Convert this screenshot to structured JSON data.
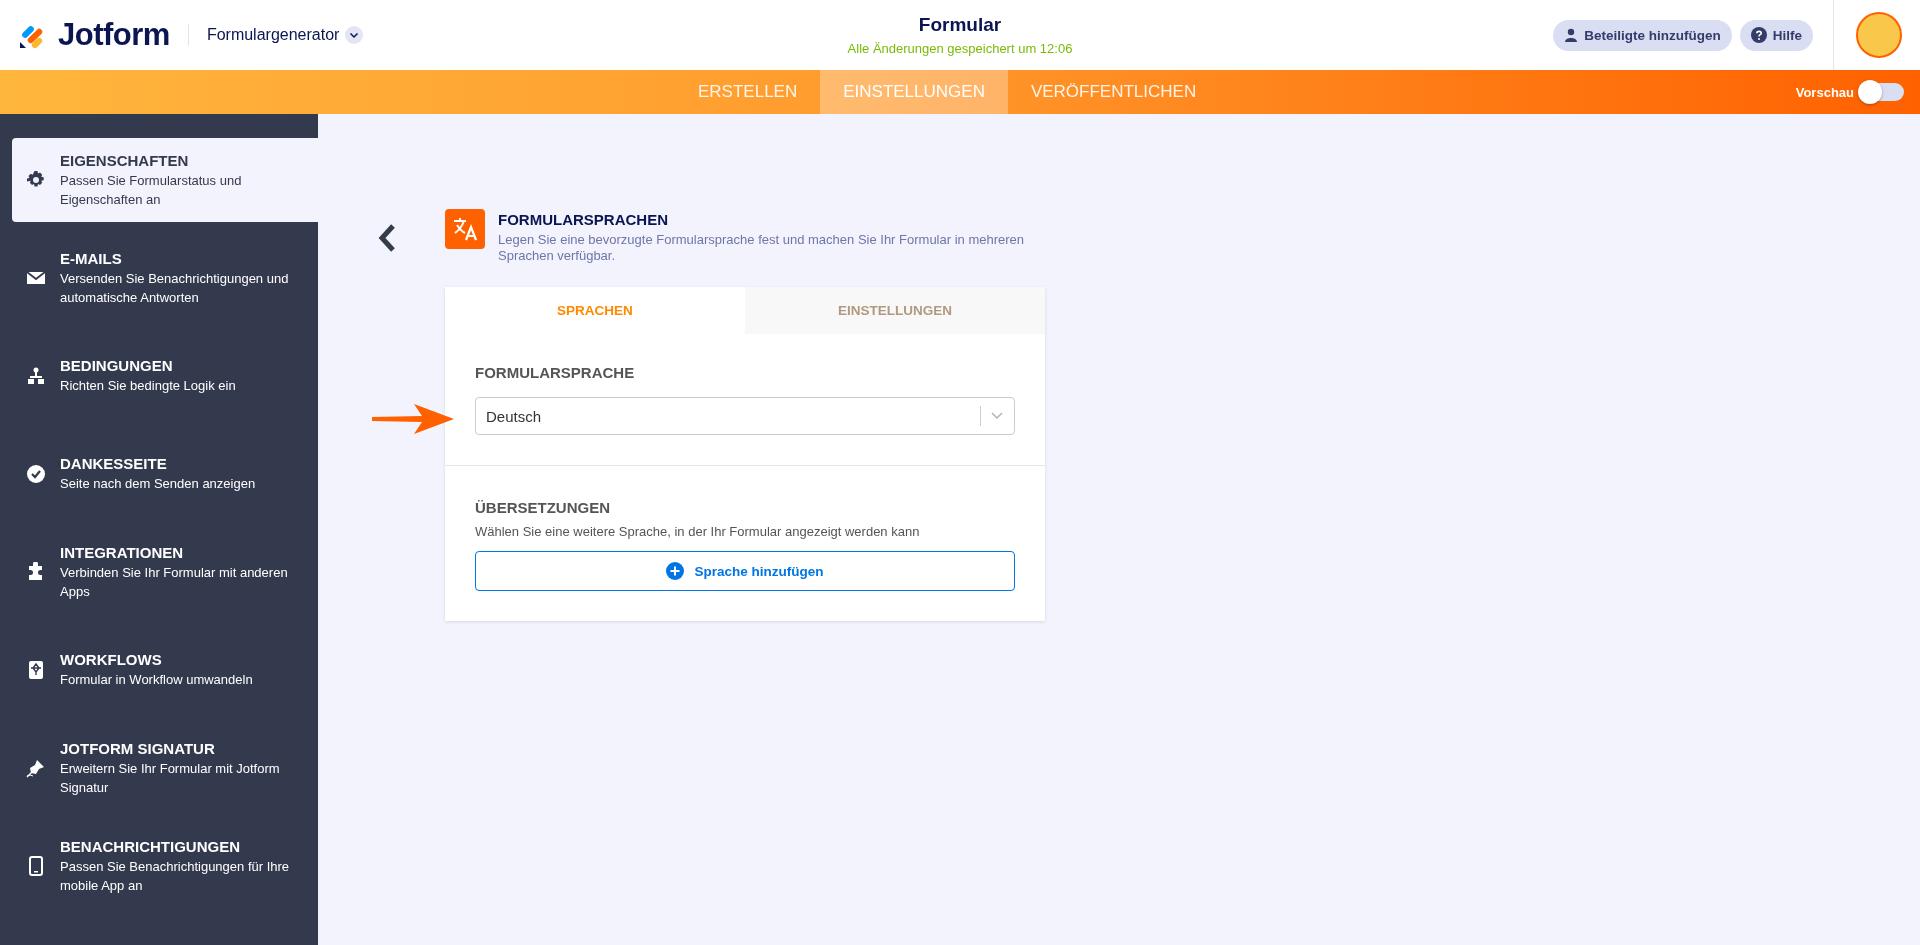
{
  "header": {
    "logo": "Jotform",
    "app_switcher": "Formulargenerator",
    "title": "Formular",
    "save_status": "Alle Änderungen gespeichert um 12:06",
    "buttons": [
      "Beteiligte hinzufügen",
      "Hilfe"
    ]
  },
  "nav": {
    "tabs": [
      {
        "label": "ERSTELLEN",
        "selected": false
      },
      {
        "label": "EINSTELLUNGEN",
        "selected": true
      },
      {
        "label": "VERÖFFENTLICHEN",
        "selected": false
      }
    ],
    "preview": {
      "label": "Vorschau",
      "on": false
    }
  },
  "sidebar": {
    "items": [
      {
        "title": "EIGENSCHAFTEN",
        "description": "Passen Sie Formularstatus und Eigenschaften an",
        "selected": true
      },
      {
        "title": "E-MAILS",
        "description": "Versenden Sie Benachrichtigungen und automatische Antworten",
        "selected": false
      },
      {
        "title": "BEDINGUNGEN",
        "description": "Richten Sie bedingte Logik ein",
        "selected": false
      },
      {
        "title": "DANKESSEITE",
        "description": "Seite nach dem Senden anzeigen",
        "selected": false
      },
      {
        "title": "INTEGRATIONEN",
        "description": "Verbinden Sie Ihr Formular mit anderen Apps",
        "selected": false
      },
      {
        "title": "WORKFLOWS",
        "description": "Formular in Workflow umwandeln",
        "selected": false
      },
      {
        "title": "JOTFORM SIGNATUR",
        "description": "Erweitern Sie Ihr Formular mit Jotform Signatur",
        "selected": false
      },
      {
        "title": "BENACHRICHTIGUNGEN",
        "description": "Passen Sie Benachrichtigungen für Ihre mobile App an",
        "selected": false
      }
    ]
  },
  "section": {
    "title": "FORMULARSPRACHEN",
    "description": "Legen Sie eine bevorzugte Formularsprache fest und machen Sie Ihr Formular in mehreren Sprachen verfügbar.",
    "tabs": [
      {
        "label": "SPRACHEN",
        "selected": true
      },
      {
        "label": "EINSTELLUNGEN",
        "selected": false
      }
    ],
    "form_language": {
      "label": "FORMULARSPRACHE",
      "value": "Deutsch"
    },
    "translations": {
      "label": "ÜBERSETZUNGEN",
      "description": "Wählen Sie eine weitere Sprache, in der Ihr Formular angezeigt werden kann",
      "button": "Sprache hinzufügen"
    }
  }
}
